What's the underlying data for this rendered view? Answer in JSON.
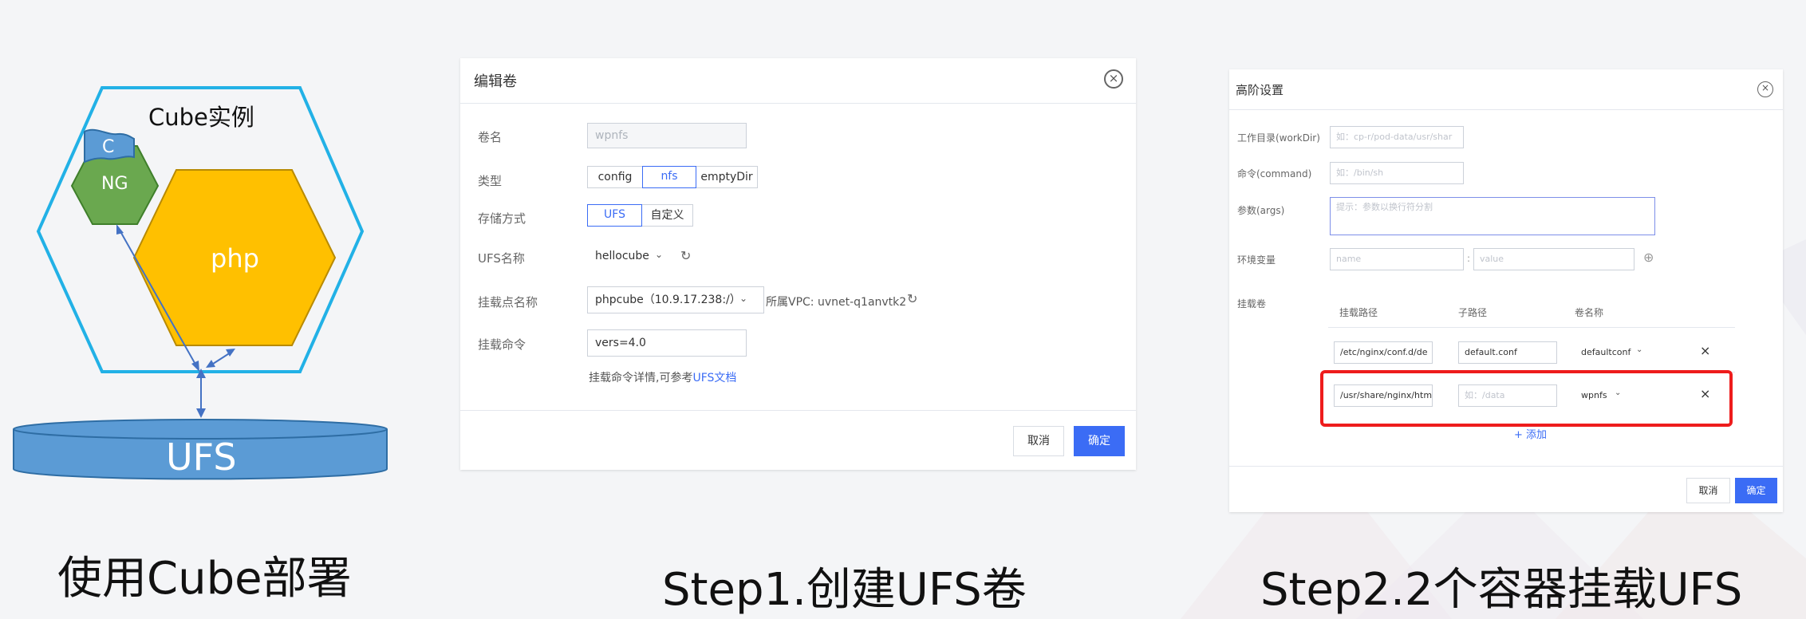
{
  "diagram": {
    "instance_label": "Cube实例",
    "c_label": "C",
    "ng_label": "NG",
    "php_label": "php",
    "ufs_label": "UFS",
    "caption": "使用Cube部署"
  },
  "dialog1": {
    "title": "编辑卷",
    "fields": {
      "volume_name_label": "卷名",
      "volume_name_value": "wpnfs",
      "type_label": "类型",
      "type_options": [
        "config",
        "nfs",
        "emptyDir"
      ],
      "type_selected": "nfs",
      "storage_label": "存储方式",
      "storage_options": [
        "UFS",
        "自定义"
      ],
      "storage_selected": "UFS",
      "ufs_name_label": "UFS名称",
      "ufs_name_value": "hellocube",
      "mount_point_label": "挂载点名称",
      "mount_point_value": "phpcube（10.9.17.238:/）",
      "vpc_text": "所属VPC: uvnet-q1anvtk2",
      "mount_cmd_label": "挂载命令",
      "mount_cmd_value": "vers=4.0",
      "help_text": "挂载命令详情,可参考",
      "help_link": "UFS文档"
    },
    "cancel_label": "取消",
    "ok_label": "确定",
    "caption": "Step1.创建UFS卷"
  },
  "dialog2": {
    "title": "高阶设置",
    "workdir_label": "工作目录(workDir)",
    "workdir_placeholder": "如：cp-r/pod-data/usr/shar",
    "command_label": "命令(command)",
    "command_placeholder": "如：/bin/sh",
    "args_label": "参数(args)",
    "args_placeholder": "提示：参数以换行符分割",
    "env_label": "环境变量",
    "env_name_placeholder": "name",
    "env_value_placeholder": "value",
    "env_separator": ":",
    "mount_label": "挂载卷",
    "columns": [
      "挂载路径",
      "子路径",
      "卷名称"
    ],
    "rows": [
      {
        "path": "/etc/nginx/conf.d/de",
        "subpath": "default.conf",
        "subpath_placeholder": "",
        "volume": "defaultconf"
      },
      {
        "path": "/usr/share/nginx/htm",
        "subpath": "",
        "subpath_placeholder": "如：/data",
        "volume": "wpnfs"
      }
    ],
    "add_label": "+ 添加",
    "cancel_label": "取消",
    "ok_label": "确定",
    "caption": "Step2.2个容器挂载UFS"
  },
  "colors": {
    "accent": "#3b6cf5",
    "highlight": "#ee1c1c",
    "hex_outline": "#22b1e6",
    "ng_green": "#6aa84f",
    "php_yellow": "#ffc000",
    "ufs_blue": "#5b9bd5"
  }
}
